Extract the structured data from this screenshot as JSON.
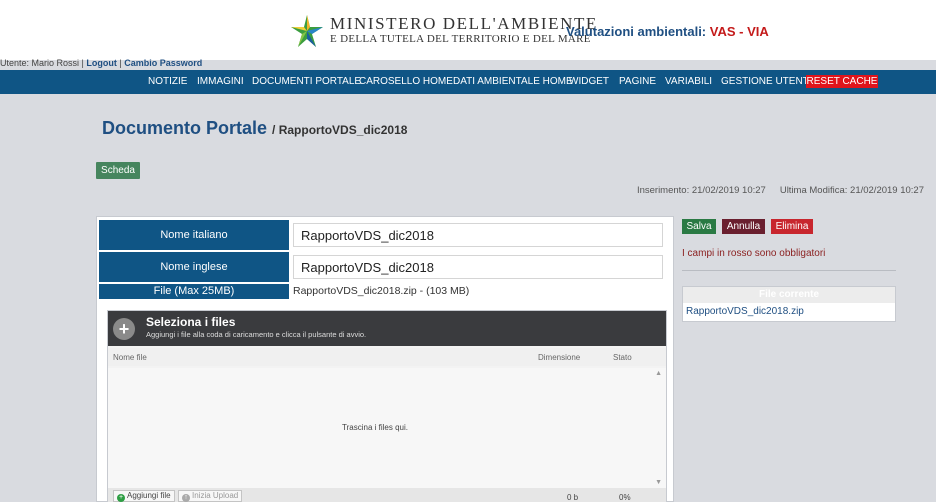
{
  "header": {
    "ministry_line1": "MINISTERO DELL'AMBIENTE",
    "ministry_line2": "E DELLA TUTELA DEL TERRITORIO E DEL MARE",
    "site_title": "Valutazioni ambientali:",
    "site_title_accent": "VAS - VIA"
  },
  "userbar": {
    "user_text": "Utente: Mario Rossi |",
    "logout": "Logout",
    "separator": "|",
    "change_password": "Cambio Password"
  },
  "nav": {
    "items": [
      "NOTIZIE",
      "IMMAGINI",
      "DOCUMENTI PORTALE",
      "CAROSELLO HOME",
      "DATI AMBIENTALE HOME",
      "WIDGET",
      "PAGINE",
      "VARIABILI",
      "GESTIONE UTENTI"
    ],
    "reset_cache": "RESET CACHE"
  },
  "page": {
    "title": "Documento Portale",
    "subtitle": "/ RapportoVDS_dic2018",
    "tab_label": "Scheda",
    "created": "Inserimento: 21/02/2019 10:27",
    "modified": "Ultima Modifica: 21/02/2019 10:27"
  },
  "form": {
    "name_it_label": "Nome italiano",
    "name_it_value": "RapportoVDS_dic2018",
    "name_en_label": "Nome inglese",
    "name_en_value": "RapportoVDS_dic2018",
    "file_label": "File (Max 25MB)",
    "file_value": "RapportoVDS_dic2018.zip - (103 MB)"
  },
  "uploader": {
    "title": "Seleziona i files",
    "hint": "Aggiungi i file alla coda di caricamento e clicca il pulsante di avvio.",
    "col_name": "Nome file",
    "col_size": "Dimensione",
    "col_status": "Stato",
    "drop_text": "Trascina i files qui.",
    "add_button": "Aggiungi file",
    "start_button": "Inizia Upload",
    "total_size": "0 b",
    "total_percent": "0%"
  },
  "actions": {
    "save": "Salva",
    "cancel": "Annulla",
    "delete": "Elimina",
    "required_note": "I campi in rosso sono obbligatori"
  },
  "current_file": {
    "header": "File corrente",
    "name": "RapportoVDS_dic2018.zip"
  },
  "colors": {
    "nav_bg": "#0f5585",
    "reset_cache": "#e0141b",
    "save": "#2a7a44",
    "cancel": "#6a1f2f",
    "delete": "#c8262e"
  }
}
